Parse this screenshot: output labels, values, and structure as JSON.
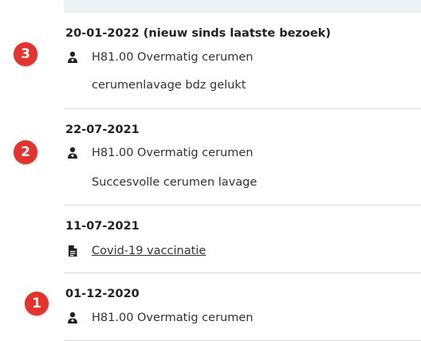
{
  "entries": [
    {
      "date": "20-01-2022 (nieuw sinds laatste bezoek)",
      "item": "H81.00 Overmatig cerumen",
      "item_icon": "doctor-icon",
      "note": "cerumenlavage bdz gelukt",
      "badge": "3"
    },
    {
      "date": "22-07-2021",
      "item": "H81.00 Overmatig cerumen",
      "item_icon": "doctor-icon",
      "note": "Succesvolle cerumen lavage",
      "badge": "2"
    },
    {
      "date": "11-07-2021",
      "item": "Covid-19 vaccinatie",
      "item_icon": "document-icon"
    },
    {
      "date": "01-12-2020",
      "item": "H81.00 Overmatig cerumen",
      "item_icon": "doctor-icon",
      "badge": "1"
    }
  ],
  "colors": {
    "badge": "#e2332f",
    "divider": "#dddddd",
    "top_band": "#eef2f7"
  }
}
